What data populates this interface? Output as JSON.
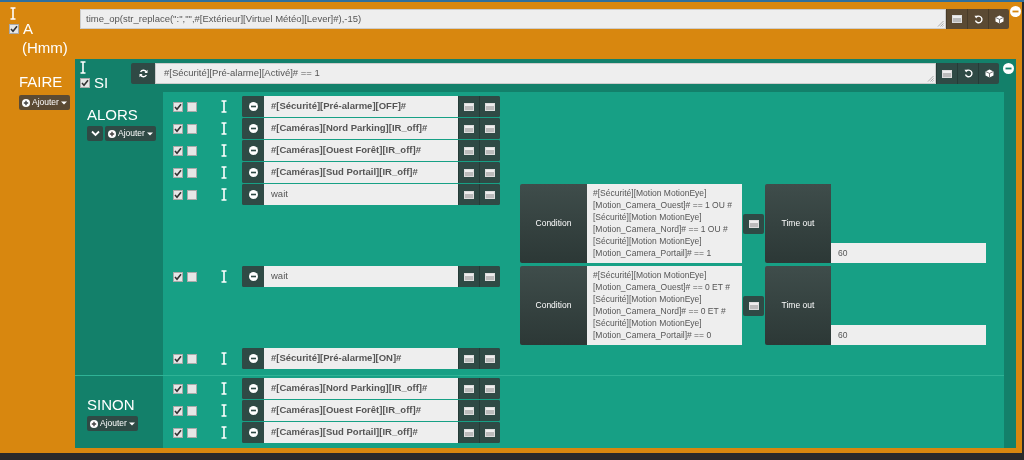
{
  "trigger_block": {
    "label": "A",
    "unit": "(Hmm)",
    "enabled": true,
    "expression": "time_op(str_replace(\":\",\"\",#[Extérieur][Virtuel Météo][Lever]#),-15)",
    "do_label": "FAIRE",
    "add_button": "Ajouter"
  },
  "if_block": {
    "label": "SI",
    "enabled": true,
    "condition": "#[Sécurité][Pré-alarme][Activé]# == 1",
    "sections": [
      {
        "label": "ALORS",
        "collapsible": true,
        "add_button": "Ajouter",
        "actions": [
          {
            "kind": "action",
            "enabled": true,
            "parallel": false,
            "expression": "#[Sécurité][Pré-alarme][OFF]#"
          },
          {
            "kind": "action",
            "enabled": true,
            "parallel": false,
            "expression": "#[Caméras][Nord Parking][IR_off]#"
          },
          {
            "kind": "action",
            "enabled": true,
            "parallel": false,
            "expression": "#[Caméras][Ouest Forêt][IR_off]#"
          },
          {
            "kind": "action",
            "enabled": true,
            "parallel": false,
            "expression": "#[Caméras][Sud Portail][IR_off]#"
          },
          {
            "kind": "wait",
            "enabled": true,
            "parallel": false,
            "expression": "wait",
            "condition_label": "Condition",
            "condition": "#[Sécurité][Motion MotionEye][Motion_Camera_Ouest]# == 1 OU #[Sécurité][Motion MotionEye][Motion_Camera_Nord]# == 1 OU #[Sécurité][Motion MotionEye][Motion_Camera_Portail]# == 1",
            "timeout_label": "Time out",
            "timeout": "60"
          },
          {
            "kind": "wait",
            "enabled": true,
            "parallel": false,
            "expression": "wait",
            "condition_label": "Condition",
            "condition": "#[Sécurité][Motion MotionEye][Motion_Camera_Ouest]# == 0 ET #[Sécurité][Motion MotionEye][Motion_Camera_Nord]# == 0 ET #[Sécurité][Motion MotionEye][Motion_Camera_Portail]# == 0",
            "timeout_label": "Time out",
            "timeout": "60"
          },
          {
            "kind": "action",
            "enabled": true,
            "parallel": false,
            "expression": "#[Sécurité][Pré-alarme][ON]#"
          }
        ]
      },
      {
        "label": "SINON",
        "collapsible": false,
        "add_button": "Ajouter",
        "actions": [
          {
            "kind": "action",
            "enabled": true,
            "parallel": false,
            "expression": "#[Caméras][Nord Parking][IR_off]#"
          },
          {
            "kind": "action",
            "enabled": true,
            "parallel": false,
            "expression": "#[Caméras][Ouest Forêt][IR_off]#"
          },
          {
            "kind": "action",
            "enabled": true,
            "parallel": false,
            "expression": "#[Caméras][Sud Portail][IR_off]#"
          }
        ]
      }
    ]
  }
}
